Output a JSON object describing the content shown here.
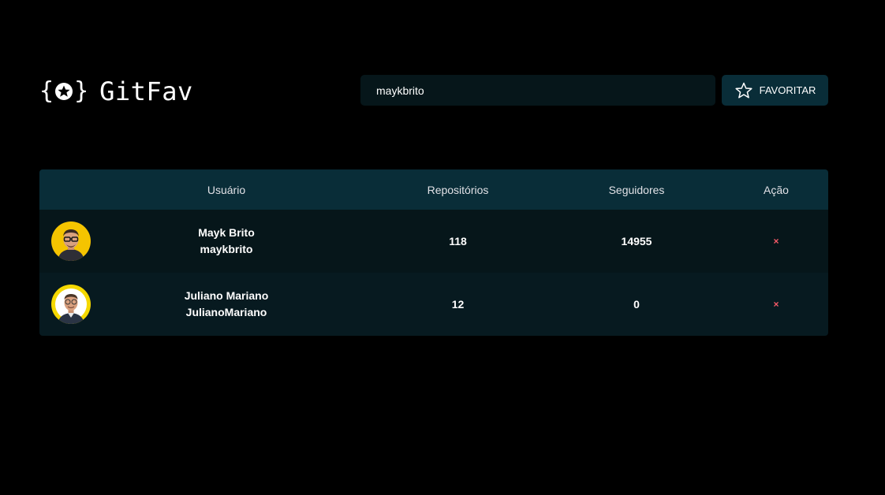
{
  "app": {
    "name": "GitFav"
  },
  "search": {
    "value": "maykbrito"
  },
  "favorite_button": {
    "label": "FAVORITAR",
    "icon": "star-icon"
  },
  "table": {
    "headers": {
      "user": "Usuário",
      "repos": "Repositórios",
      "followers": "Seguidores",
      "action": "Ação"
    },
    "rows": [
      {
        "name": "Mayk Brito",
        "login": "maykbrito",
        "repos": "118",
        "followers": "14955",
        "remove": "×"
      },
      {
        "name": "Juliano Mariano",
        "login": "JulianoMariano",
        "repos": "12",
        "followers": "0",
        "remove": "×"
      }
    ]
  },
  "colors": {
    "background": "#000000",
    "header_row": "#092d38",
    "input_bg": "#06161a",
    "remove": "#f75a68"
  }
}
